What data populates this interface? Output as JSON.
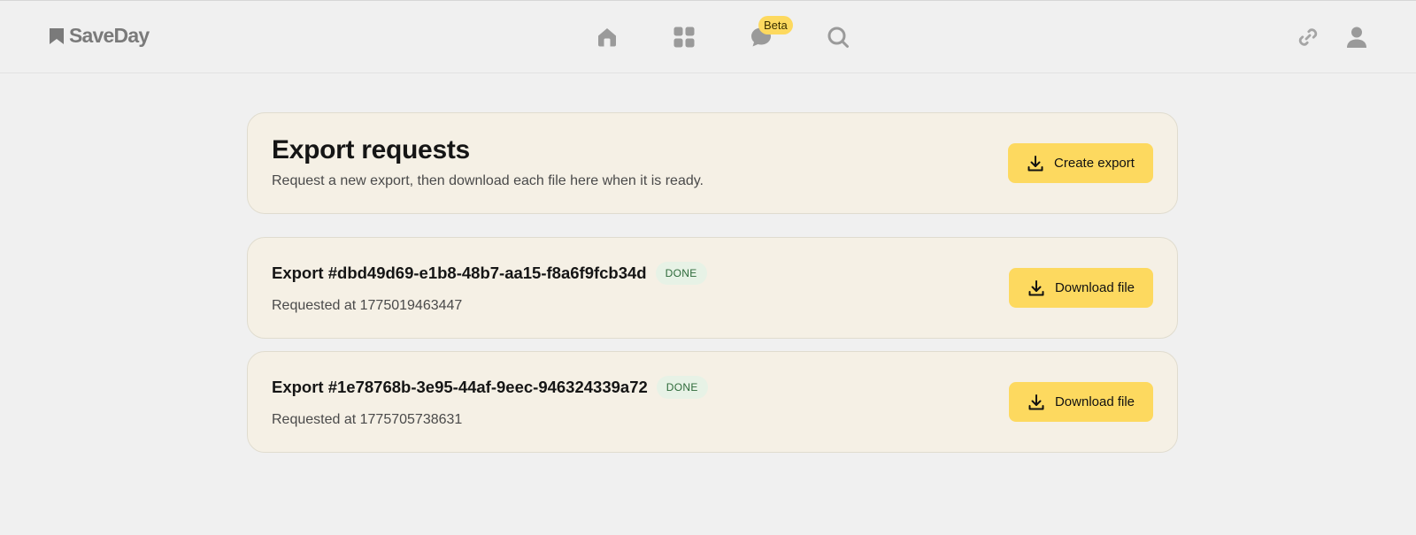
{
  "app": {
    "name": "SaveDay",
    "icons": {
      "logo": "bookmark-icon",
      "home": "home-icon",
      "grid": "grid-icon",
      "chat": "chat-icon",
      "search": "search-icon",
      "link": "link-icon",
      "profile": "user-icon"
    },
    "beta_label": "Beta"
  },
  "page": {
    "title": "Export requests",
    "subtitle": "Request a new export, then download each file here when it is ready.",
    "create_button": "Create export"
  },
  "exports": [
    {
      "title": "Export #dbd49d69-e1b8-48b7-aa15-f8a6f9fcb34d",
      "status": "DONE",
      "requested": "Requested at 1775019463447",
      "button": "Download file"
    },
    {
      "title": "Export #1e78768b-3e95-44af-9eec-946324339a72",
      "status": "DONE",
      "requested": "Requested at 1775705738631",
      "button": "Download file"
    }
  ],
  "colors": {
    "accent": "#fdd95f",
    "card_bg": "#f5f0e5",
    "page_bg": "#f0f0f0",
    "icon_gray": "#9a9a9a",
    "status_done_bg": "#e7f2e6",
    "status_done_text": "#2e6a3a"
  }
}
